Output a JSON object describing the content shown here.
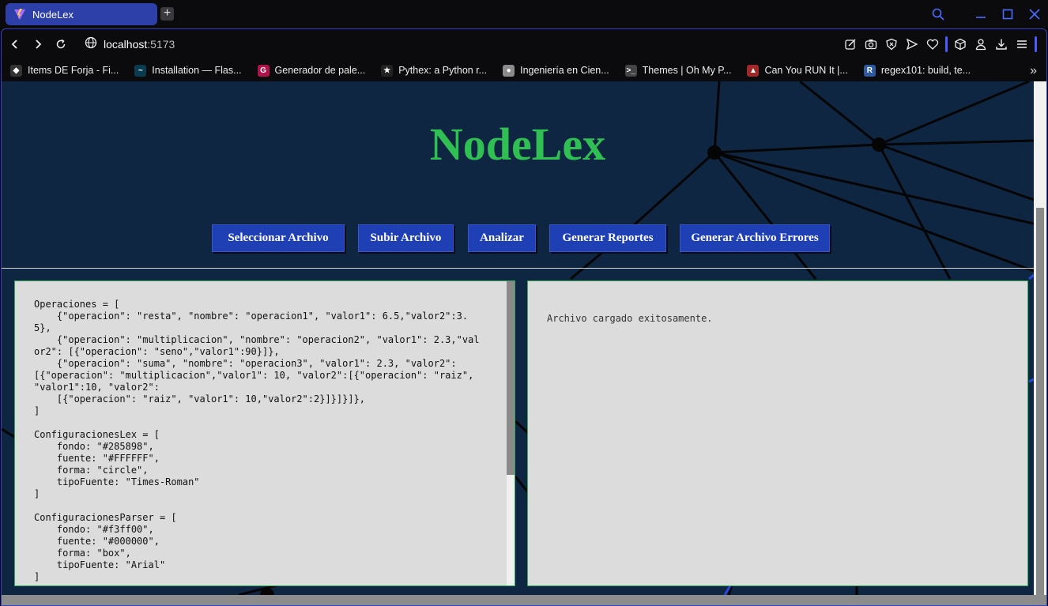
{
  "browser": {
    "tab_title": "NodeLex",
    "new_tab_symbol": "+",
    "url_host": "localhost",
    "url_port": ":5173",
    "bookmarks": [
      {
        "label": "Items DE Forja - Fi...",
        "color": "#333333",
        "glyph": "◆"
      },
      {
        "label": "Installation — Flas...",
        "color": "#0b3b4f",
        "glyph": "~"
      },
      {
        "label": "Generador de pale...",
        "color": "#b0124a",
        "glyph": "G"
      },
      {
        "label": "Pythex: a Python r...",
        "color": "#222222",
        "glyph": "★"
      },
      {
        "label": "Ingeniería en Cien...",
        "color": "#8b8b8b",
        "glyph": "●"
      },
      {
        "label": "Themes | Oh My P...",
        "color": "#444444",
        "glyph": ">_"
      },
      {
        "label": "Can You RUN It |...",
        "color": "#a02828",
        "glyph": "▲"
      },
      {
        "label": "regex101: build, te...",
        "color": "#2e5aa0",
        "glyph": "R"
      }
    ],
    "bookmarks_more": "»"
  },
  "page": {
    "title": "NodeLex",
    "buttons": [
      {
        "label": "Seleccionar Archivo"
      },
      {
        "label": "Subir Archivo"
      },
      {
        "label": "Analizar"
      },
      {
        "label": "Generar Reportes"
      },
      {
        "label": "Generar Archivo Errores"
      }
    ],
    "input_code": "Operaciones = [\n    {\"operacion\": \"resta\", \"nombre\": \"operacion1\", \"valor1\": 6.5,\"valor2\":3.\n5},\n    {\"operacion\": \"multiplicacion\", \"nombre\": \"operacion2\", \"valor1\": 2.3,\"val\nor2\": [{\"operacion\": \"seno\",\"valor1\":90}]},\n    {\"operacion\": \"suma\", \"nombre\": \"operacion3\", \"valor1\": 2.3, \"valor2\":\n[{\"operacion\": \"multiplicacion\",\"valor1\": 10, \"valor2\":[{\"operacion\": \"raiz\",\n\"valor1\":10, \"valor2\":\n    [{\"operacion\": \"raiz\", \"valor1\": 10,\"valor2\":2}]}]}]},\n]\n\nConfiguracionesLex = [\n    fondo: \"#285898\",\n    fuente: \"#FFFFFF\",\n    forma: \"circle\",\n    tipoFuente: \"Times-Roman\"\n]\n\nConfiguracionesParser = [\n    fondo: \"#f3ff00\",\n    fuente: \"#000000\",\n    forma: \"box\",\n    tipoFuente: \"Arial\"\n]",
    "output_text": "Archivo cargado exitosamente."
  },
  "colors": {
    "accent_tab": "#2d3fa8",
    "page_bg": "#0f2642",
    "title_green": "#2fbf52",
    "button_blue": "#1f3fb4",
    "panel_bg": "#dcdcdc",
    "panel_border": "#2faa55"
  }
}
